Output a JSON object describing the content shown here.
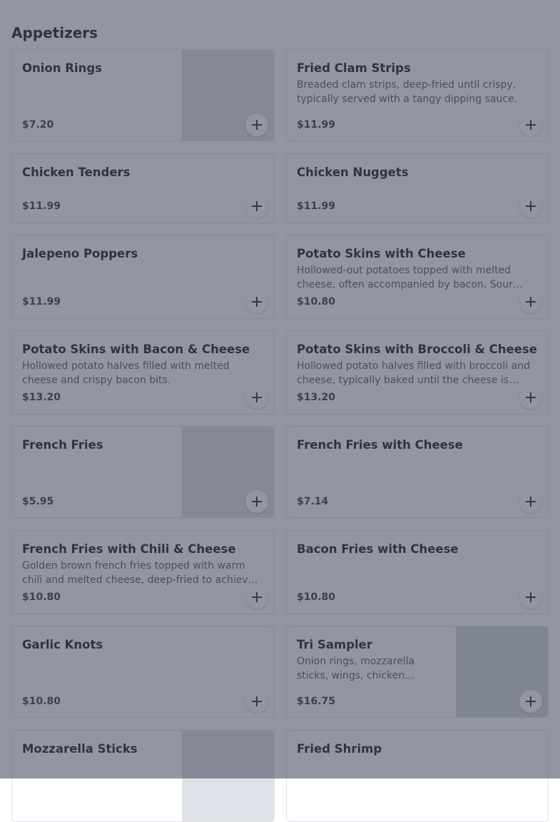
{
  "section": {
    "title": "Appetizers"
  },
  "items": [
    {
      "name": "Onion Rings",
      "description": "",
      "price": "$7.20",
      "has_image": true
    },
    {
      "name": "Fried Clam Strips",
      "description": "Breaded clam strips, deep-fried until crispy, typically served with a tangy dipping sauce.",
      "price": "$11.99",
      "has_image": false
    },
    {
      "name": "Chicken Tenders",
      "description": "",
      "price": "$11.99",
      "has_image": false
    },
    {
      "name": "Chicken Nuggets",
      "description": "",
      "price": "$11.99",
      "has_image": false
    },
    {
      "name": "Jalepeno Poppers",
      "description": "",
      "price": "$11.99",
      "has_image": false
    },
    {
      "name": "Potato Skins with Cheese",
      "description": "Hollowed-out potatoes topped with melted cheese, often accompanied by bacon. Sour…",
      "price": "$10.80",
      "has_image": false
    },
    {
      "name": "Potato Skins with Bacon & Cheese",
      "description": "Hollowed potato halves filled with melted cheese and crispy bacon bits.",
      "price": "$13.20",
      "has_image": false
    },
    {
      "name": "Potato Skins with Broccoli & Cheese",
      "description": "Hollowed potato halves filled with broccoli and cheese, typically baked until the cheese is…",
      "price": "$13.20",
      "has_image": false
    },
    {
      "name": "French Fries",
      "description": "",
      "price": "$5.95",
      "has_image": true
    },
    {
      "name": "French Fries with Cheese",
      "description": "",
      "price": "$7.14",
      "has_image": false
    },
    {
      "name": "French Fries with Chili & Cheese",
      "description": "Golden brown french fries topped with warm chili and melted cheese, deep-fried to achiev…",
      "price": "$10.80",
      "has_image": false
    },
    {
      "name": "Bacon Fries with Cheese",
      "description": "",
      "price": "$10.80",
      "has_image": false
    },
    {
      "name": "Garlic Knots",
      "description": "",
      "price": "$10.80",
      "has_image": false
    },
    {
      "name": "Tri Sampler",
      "description": "Onion rings, mozzarella sticks, wings, chicken…",
      "price": "$16.75",
      "has_image": true
    },
    {
      "name": "Mozzarella Sticks",
      "description": "",
      "price": "",
      "has_image": true
    },
    {
      "name": "Fried Shrimp",
      "description": "",
      "price": "",
      "has_image": false
    }
  ],
  "add_button": {
    "icon": "plus-icon"
  },
  "colors": {
    "overlay": "#3a4054",
    "card_border": "#e2e4ea",
    "thumb_placeholder": "#dfe2e8"
  }
}
